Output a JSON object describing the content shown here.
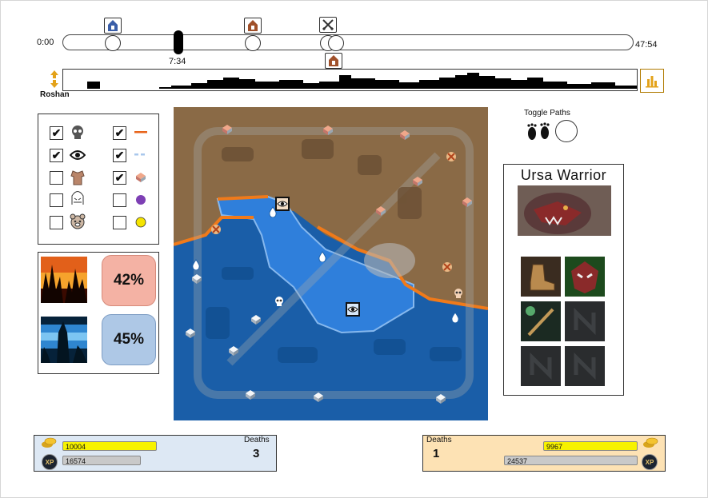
{
  "timeline": {
    "start_label": "0:00",
    "end_label": "47:54",
    "current_label": "7:34"
  },
  "histogram": {
    "label": "Roshan"
  },
  "filters": {
    "rows": [
      {
        "left_checked": true,
        "left_icon": "skull-icon",
        "right_checked": true,
        "right_icon": "orange-line-icon"
      },
      {
        "left_checked": true,
        "left_icon": "eye-icon",
        "right_checked": true,
        "right_icon": "blue-dashed-line-icon"
      },
      {
        "left_checked": false,
        "left_icon": "armor-icon",
        "right_checked": true,
        "right_icon": "tower-icon"
      },
      {
        "left_checked": false,
        "left_icon": "ancient-icon",
        "right_checked": false,
        "right_icon": "purple-dot-icon"
      },
      {
        "left_checked": false,
        "left_icon": "courier-icon",
        "right_checked": false,
        "right_icon": "yellow-dot-icon"
      }
    ]
  },
  "win": {
    "dire_pct": "42%",
    "radiant_pct": "45%"
  },
  "toggle_paths": {
    "label": "Toggle Paths"
  },
  "hero": {
    "name": "Ursa Warrior"
  },
  "radiant": {
    "gold": "10004",
    "xp": "16574",
    "deaths_label": "Deaths",
    "deaths": "3",
    "xp_badge": "XP"
  },
  "dire": {
    "gold": "9967",
    "xp": "24537",
    "deaths_label": "Deaths",
    "deaths": "1",
    "xp_badge": "XP"
  },
  "colors": {
    "dire": "#c0441a",
    "radiant": "#1d5fb4",
    "gold_bar": "#f7f200",
    "xp_bar": "#c9c9c9",
    "radiant_panel": "#dde8f4",
    "dire_panel": "#fde2b4"
  }
}
